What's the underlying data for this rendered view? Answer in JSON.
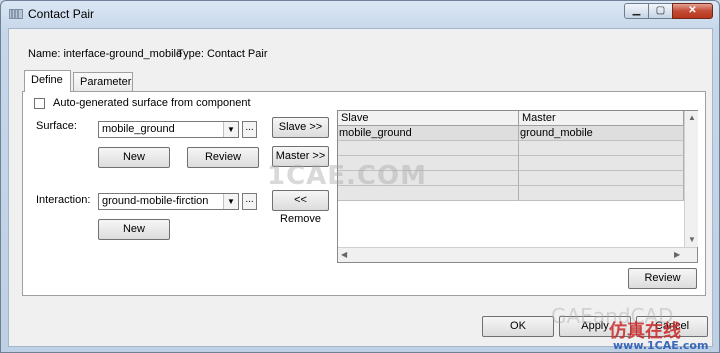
{
  "window": {
    "title": "Contact Pair"
  },
  "titlebar": {
    "minimize_glyph": "▁",
    "maximize_glyph": "▢",
    "close_glyph": "✕"
  },
  "info": {
    "name_line": "Name: interface-ground_mobile",
    "type_line": "Type: Contact Pair"
  },
  "tabs": [
    {
      "label": "Define"
    },
    {
      "label": "Parameter"
    }
  ],
  "define": {
    "autogen_label": "Auto-generated surface from component",
    "surface_label": "Surface:",
    "surface_value": "mobile_ground",
    "new1_label": "New",
    "review1_label": "Review",
    "interaction_label": "Interaction:",
    "interaction_value": "ground-mobile-firction",
    "new2_label": "New",
    "slave_btn": "Slave >>",
    "master_btn": "Master >>",
    "remove_btn": "<< Remove",
    "dots": "..."
  },
  "table": {
    "headers": [
      "Slave",
      "Master"
    ],
    "rows": [
      [
        "mobile_ground",
        "ground_mobile"
      ]
    ]
  },
  "review_btn": "Review",
  "footer": {
    "ok": "OK",
    "apply": "Apply",
    "cancel": "Cancel"
  },
  "watermarks": {
    "center": "1CAE.COM",
    "brand": "GAEandCAD",
    "site": "www.1CAE.com",
    "chinese": "仿真在线"
  }
}
